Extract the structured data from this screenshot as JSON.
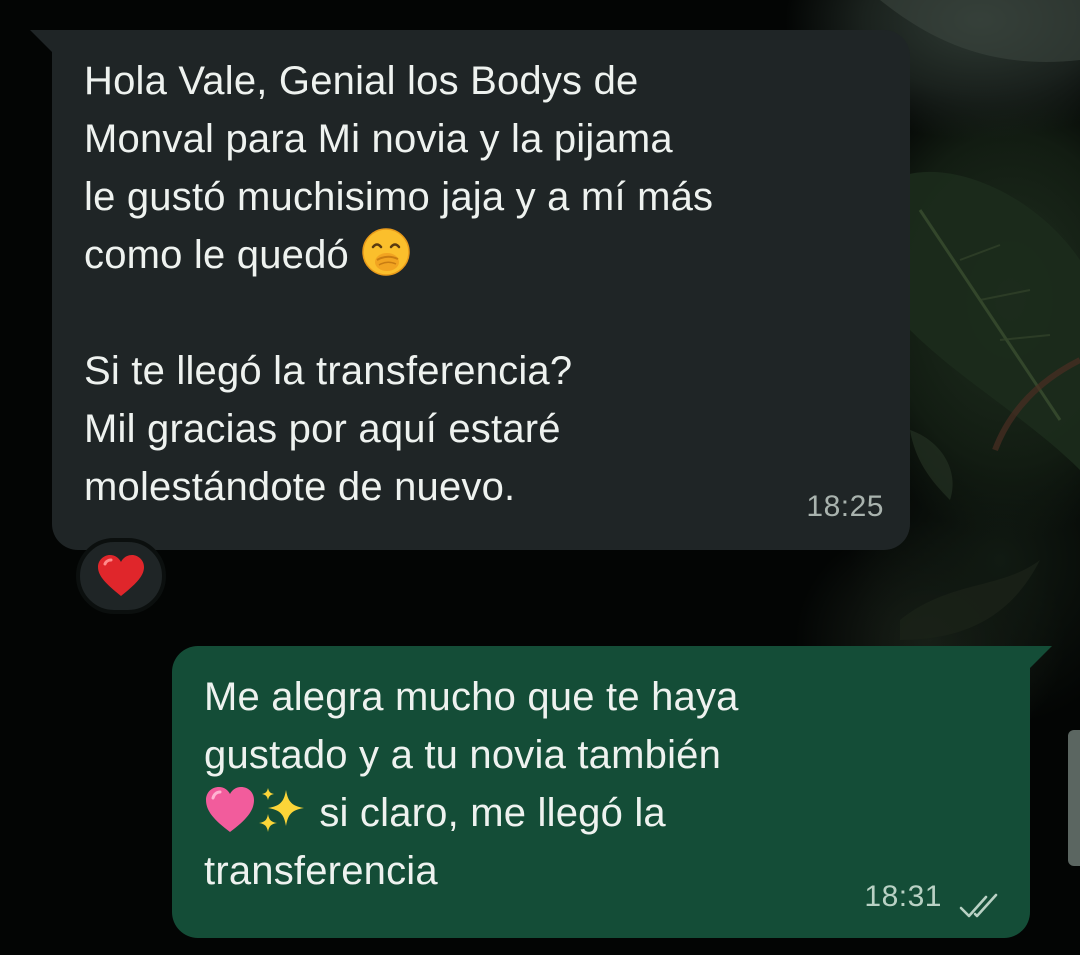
{
  "conversation": {
    "incoming_message": {
      "text_part1": "Hola Vale, Genial los Bodys de\nMonval para Mi novia y la pijama\nle gustó muchisimo jaja y a mí más\ncomo le quedó ",
      "emoji1": "face-with-hand-over-mouth",
      "text_part2": "\n\nSi te llegó la transferencia?\nMil gracias por aquí estaré\nmolestándote de nuevo.",
      "time": "18:25",
      "reaction": "red-heart"
    },
    "outgoing_message": {
      "text_part1": "Me alegra mucho que te haya\ngustado y a tu novia también\n",
      "emoji1": "pink-heart",
      "emoji2": "sparkles",
      "text_part2": " si claro, me llegó la\ntransferencia",
      "time": "18:31",
      "status_icon": "double-check-read"
    }
  },
  "colors": {
    "incoming_bubble": "#1f2526",
    "outgoing_bubble": "#144d37",
    "text": "#eef2ef",
    "timestamp": "#a9b3ae",
    "background": "#050807"
  }
}
